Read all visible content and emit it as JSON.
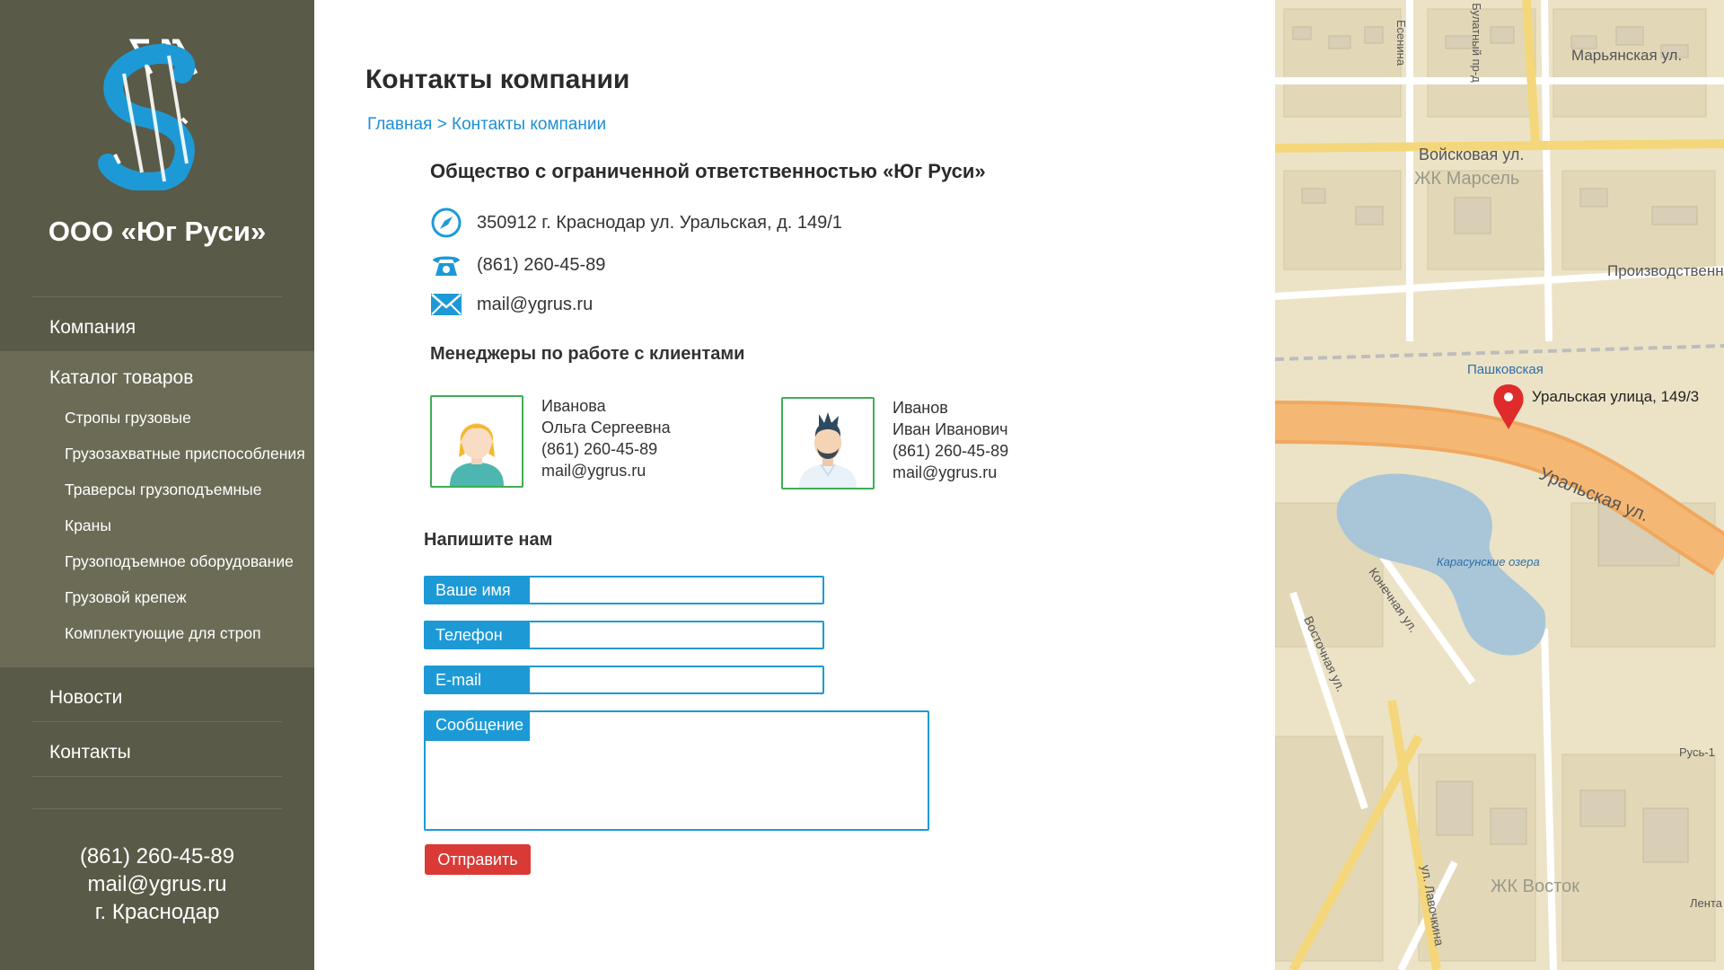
{
  "brand": {
    "name": "ООО «Юг Руси»"
  },
  "nav": {
    "company": "Компания",
    "catalog": "Каталог товаров",
    "subitems": [
      "Стропы грузовые",
      "Грузозахватные приспособления",
      "Траверсы грузоподъемные",
      "Краны",
      "Грузоподъемное оборудование",
      "Грузовой крепеж",
      "Комплектующие для строп"
    ],
    "news": "Новости",
    "contacts": "Контакты"
  },
  "sidebar_contacts": {
    "phone": "(861) 260-45-89",
    "email": "mail@ygrus.ru",
    "city": "г. Краснодар"
  },
  "page": {
    "title": "Контакты компании",
    "breadcrumb_home": "Главная",
    "breadcrumb_sep": ">",
    "breadcrumb_current": "Контакты компании"
  },
  "org": {
    "name": "Общество с ограниченной ответственностью «Юг Руси»",
    "address": "350912 г. Краснодар ул. Уральская, д. 149/1",
    "phone": "(861) 260-45-89",
    "email": "mail@ygrus.ru"
  },
  "managers": {
    "title": "Менеджеры по работе с клиентами",
    "list": [
      {
        "surname": "Иванова",
        "name": "Ольга Сергеевна",
        "phone": "(861) 260-45-89",
        "email": "mail@ygrus.ru"
      },
      {
        "surname": "Иванов",
        "name": "Иван Иванович",
        "phone": "(861) 260-45-89",
        "email": "mail@ygrus.ru"
      }
    ]
  },
  "form": {
    "title": "Напишите нам",
    "name_label": "Ваше имя",
    "phone_label": "Телефон",
    "email_label": "E-mail",
    "message_label": "Сообщение",
    "submit": "Отправить"
  },
  "map": {
    "marker_label": "Уральская улица, 149/3",
    "streets": [
      "Марьянская ул.",
      "Войсковая ул.",
      "Производственная ул.",
      "Уральская ул.",
      "Конечная ул.",
      "Восточная ул.",
      "ул. Лавочкина",
      "Булатный пр-д",
      "Есенина"
    ],
    "places": [
      "ЖК Марсель",
      "Пашковская",
      "Карасунские озера",
      "ЖК Восток",
      "Русь-1",
      "Лента"
    ]
  },
  "colors": {
    "sidebar": "#5a5a48",
    "accent": "#1d9ad6",
    "button": "#d93a35",
    "avatar_border": "#3fae55"
  }
}
